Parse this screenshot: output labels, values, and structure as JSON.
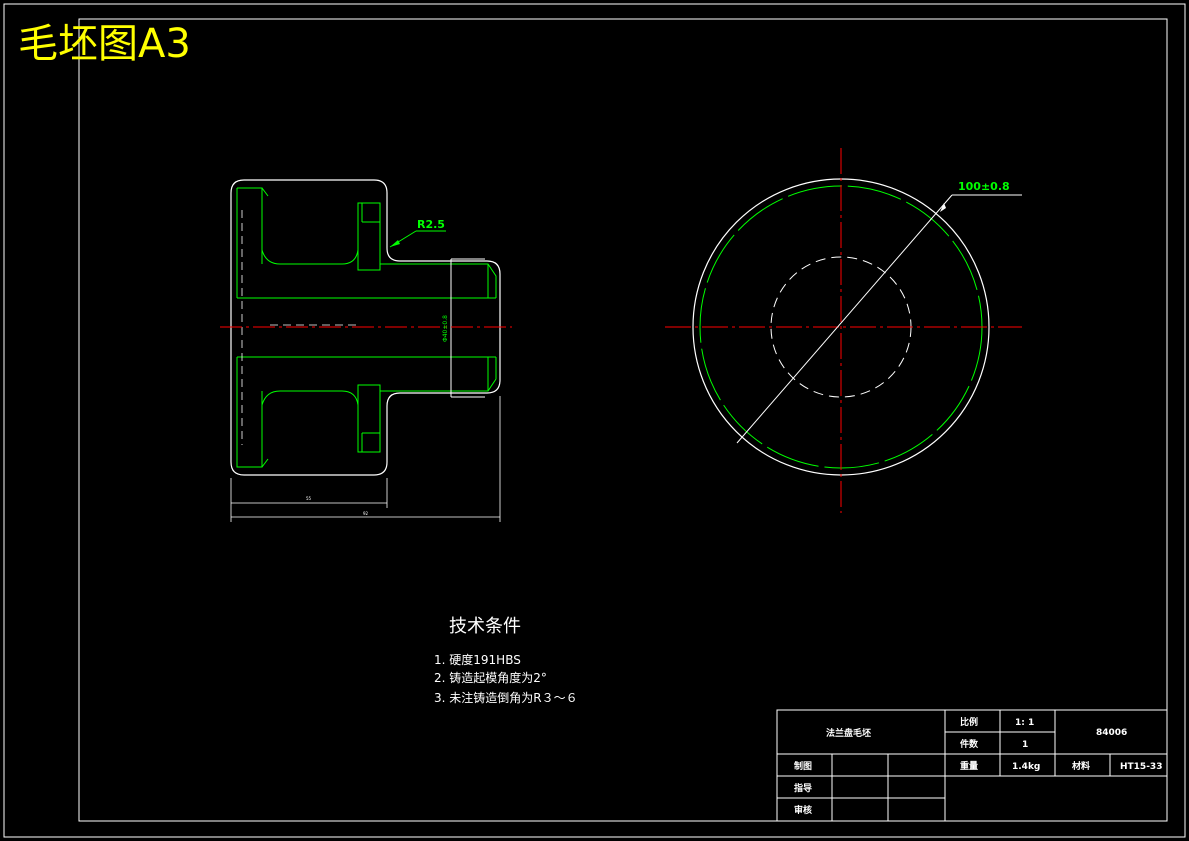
{
  "sheet_title": "毛坯图A3",
  "dimensions": {
    "radius": "R2.5",
    "diameter_circle": "100±0.8",
    "bore": "Φ40±0.8",
    "length_short": "55",
    "length_total": "92"
  },
  "tech_conditions": {
    "heading": "技术条件",
    "items": [
      "1.  硬度191HBS",
      "2.     铸造起模角度为2°",
      "3.  未注铸造倒角为R３～６"
    ]
  },
  "title_block": {
    "part_name": "法兰盘毛坯",
    "scale_label": "比例",
    "scale_value": "1: 1",
    "qty_label": "件数",
    "qty_value": "1",
    "drawing_no": "84006",
    "drawn_label": "制图",
    "guide_label": "指导",
    "review_label": "审核",
    "weight_label": "重量",
    "weight_value": "1.4kg",
    "material_label": "材料",
    "material_value": "HT15-33"
  },
  "colors": {
    "background": "#000000",
    "outline": "#ffffff",
    "geometry": "#00ff00",
    "centerline": "#ff0000",
    "title": "#ffff00"
  }
}
